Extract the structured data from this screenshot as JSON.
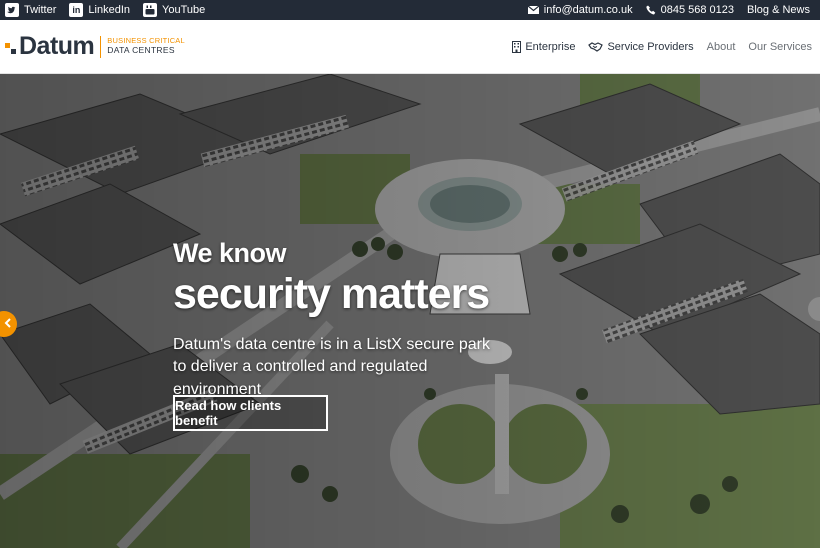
{
  "topbar": {
    "social": [
      {
        "icon": "twitter-icon",
        "label": "Twitter"
      },
      {
        "icon": "linkedin-icon",
        "label": "LinkedIn"
      },
      {
        "icon": "youtube-icon",
        "label": "YouTube"
      }
    ],
    "email": "info@datum.co.uk",
    "phone": "0845 568 0123",
    "blog_label": "Blog & News"
  },
  "logo": {
    "name": "Datum",
    "tagline_top": "BUSINESS CRITICAL",
    "tagline_bottom": "DATA CENTRES"
  },
  "nav": {
    "items": [
      {
        "label": "Enterprise",
        "icon": "building-icon"
      },
      {
        "label": "Service Providers",
        "icon": "handshake-icon"
      },
      {
        "label": "About"
      },
      {
        "label": "Our Services"
      }
    ]
  },
  "hero": {
    "subtitle": "We know",
    "title": "security matters",
    "body": "Datum's data centre is in a ListX secure park to deliver a controlled and regulated environment",
    "cta_label": "Read how clients benefit"
  },
  "colors": {
    "accent": "#f39200",
    "topbar": "#232b37",
    "brand_text": "#2b3440"
  }
}
